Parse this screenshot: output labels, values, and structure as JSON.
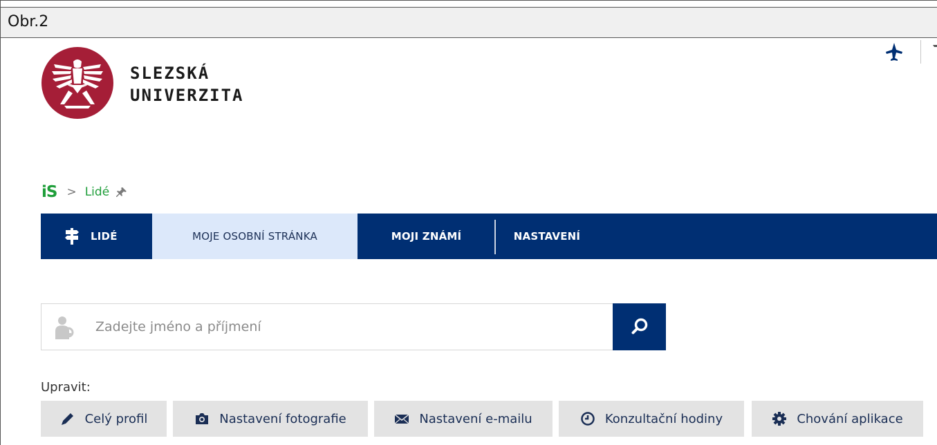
{
  "caption": "Obr.2",
  "university": {
    "line1": "SLEZSKÁ",
    "line2": "UNIVERZITA",
    "brand_color": "#a51e37"
  },
  "breadcrumb": {
    "is_logo": "iS",
    "separator": ">",
    "current": "Lidé",
    "pin_icon": "pin-icon"
  },
  "navbar": {
    "bg_color": "#002f73",
    "items": [
      {
        "label": "LIDÉ",
        "icon": "signpost-icon"
      },
      {
        "label": "MOJE OSOBNÍ STRÁNKA",
        "active": true
      },
      {
        "label": "MOJI ZNÁMÍ"
      },
      {
        "label": "NASTAVENÍ"
      }
    ]
  },
  "search": {
    "placeholder": "Zadejte jméno a příjmení",
    "value": "",
    "button_icon": "magnifier-icon"
  },
  "edit": {
    "label": "Upravit:",
    "buttons": [
      {
        "label": "Celý profil",
        "icon": "pencil-icon"
      },
      {
        "label": "Nastavení fotografie",
        "icon": "camera-icon"
      },
      {
        "label": "Nastavení e-mailu",
        "icon": "envelope-icon"
      },
      {
        "label": "Konzultační hodiny",
        "icon": "clock-icon"
      },
      {
        "label": "Chování aplikace",
        "icon": "gear-icon"
      }
    ]
  },
  "top_right": {
    "icon": "airplane-icon"
  }
}
